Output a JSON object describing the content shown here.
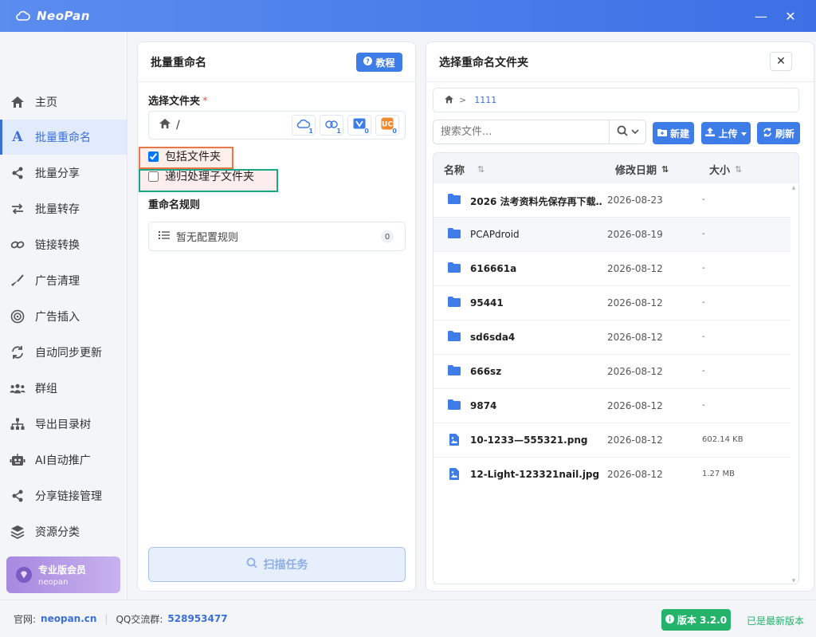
{
  "app": {
    "name": "NeoPan"
  },
  "window": {
    "minimize": "—",
    "close": "✕"
  },
  "sidebar": {
    "items": [
      {
        "label": "主页",
        "icon": "home-icon"
      },
      {
        "label": "批量重命名",
        "icon": "letter-a-icon",
        "active": true
      },
      {
        "label": "批量分享",
        "icon": "share-icon"
      },
      {
        "label": "批量转存",
        "icon": "transfer-icon"
      },
      {
        "label": "链接转换",
        "icon": "link-icon"
      },
      {
        "label": "广告清理",
        "icon": "broom-icon"
      },
      {
        "label": "广告插入",
        "icon": "target-icon"
      },
      {
        "label": "自动同步更新",
        "icon": "sync-icon"
      },
      {
        "label": "群组",
        "icon": "group-icon"
      },
      {
        "label": "导出目录树",
        "icon": "sitemap-icon"
      },
      {
        "label": "AI自动推广",
        "icon": "robot-icon"
      },
      {
        "label": "分享链接管理",
        "icon": "share-icon"
      },
      {
        "label": "资源分类",
        "icon": "layers-icon"
      }
    ],
    "pro": {
      "title": "专业版会员",
      "subtitle": "neopan"
    }
  },
  "rename_panel": {
    "title": "批量重命名",
    "tutorial_label": "教程",
    "folder_label": "选择文件夹",
    "required_mark": "*",
    "folder_path": "/",
    "cloud_buttons": [
      {
        "icon": "cloud-icon",
        "badge": "1"
      },
      {
        "icon": "cloud-sync-icon",
        "badge": "1"
      },
      {
        "icon": "send-icon",
        "badge": "0"
      },
      {
        "icon": "uc-icon",
        "badge": "0"
      }
    ],
    "include_folders_label": "包括文件夹",
    "include_folders_checked": true,
    "recursive_label": "递归处理子文件夹",
    "recursive_checked": false,
    "rules_label": "重命名规则",
    "rules_empty": "暂无配置规则",
    "rules_count": "0",
    "scan_label": "扫描任务"
  },
  "folder_panel": {
    "title": "选择重命名文件夹",
    "close_label": "✕",
    "breadcrumb": {
      "sep": ">",
      "current": "1111"
    },
    "search_placeholder": "搜索文件...",
    "new_label": "新建",
    "upload_label": "上传",
    "refresh_label": "刷新",
    "columns": {
      "name": "名称",
      "date": "修改日期",
      "size": "大小"
    },
    "files": [
      {
        "name": "2026 法考资料先保存再下载…",
        "date": "2026-08-23",
        "size": "-",
        "type": "folder"
      },
      {
        "name": "PCAPdroid",
        "date": "2026-08-19",
        "size": "-",
        "type": "folder"
      },
      {
        "name": "616661a",
        "date": "2026-08-12",
        "size": "-",
        "type": "folder"
      },
      {
        "name": "95441",
        "date": "2026-08-12",
        "size": "-",
        "type": "folder"
      },
      {
        "name": "sd6sda4",
        "date": "2026-08-12",
        "size": "-",
        "type": "folder"
      },
      {
        "name": "666sz",
        "date": "2026-08-12",
        "size": "-",
        "type": "folder"
      },
      {
        "name": "9874",
        "date": "2026-08-12",
        "size": "-",
        "type": "folder"
      },
      {
        "name": "10-1233—555321.png",
        "date": "2026-08-12",
        "size": "602.14 KB",
        "type": "image"
      },
      {
        "name": "12-Light-123321nail.jpg",
        "date": "2026-08-12",
        "size": "1.27 MB",
        "type": "image"
      }
    ]
  },
  "statusbar": {
    "site_label": "官网:",
    "site": "neopan.cn",
    "qq_label": "QQ交流群:",
    "qq": "528953477",
    "version_label": "版本 3.2.0",
    "version_status": "已是最新版本"
  },
  "colors": {
    "accent": "#3e7ce8",
    "title_bar": "#4a7eea",
    "success": "#25b36b",
    "highlight_orange": "#e8774a",
    "highlight_green": "#1aa784"
  }
}
